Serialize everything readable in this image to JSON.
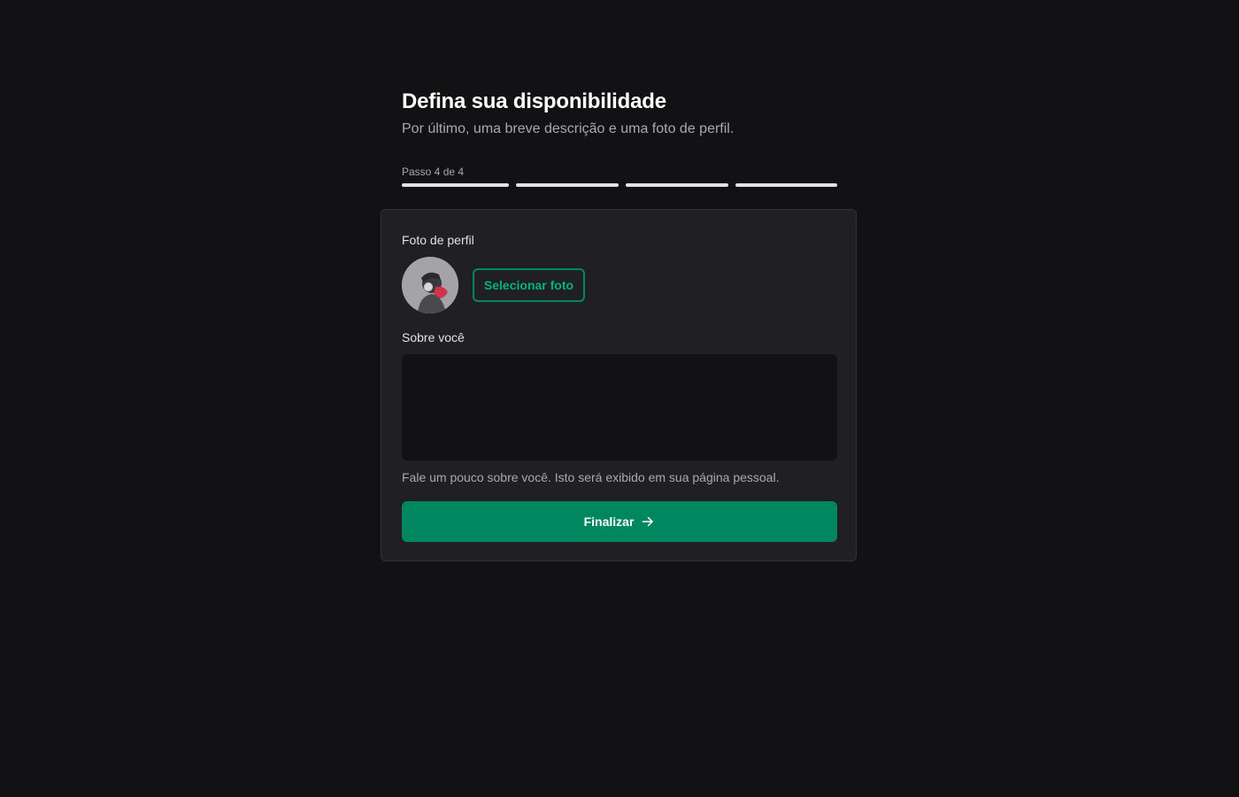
{
  "header": {
    "title": "Defina sua disponibilidade",
    "subtitle": "Por último, uma breve descrição e uma foto de perfil."
  },
  "steps": {
    "label": "Passo 4 de 4",
    "total": 4,
    "current": 4
  },
  "form": {
    "photo_label": "Foto de perfil",
    "select_photo_label": "Selecionar foto",
    "about_label": "Sobre você",
    "about_value": "",
    "about_helper": "Fale um pouco sobre você. Isto será exibido em sua página pessoal.",
    "finish_label": "Finalizar"
  },
  "icons": {
    "finish": "arrow-right-icon",
    "avatar": "avatar"
  },
  "colors": {
    "background": "#121214",
    "card": "#202024",
    "accent": "#00875f",
    "accent_text": "#00b37e",
    "step_active": "#e1e1e6",
    "avatar_scarf": "#d0344a"
  }
}
